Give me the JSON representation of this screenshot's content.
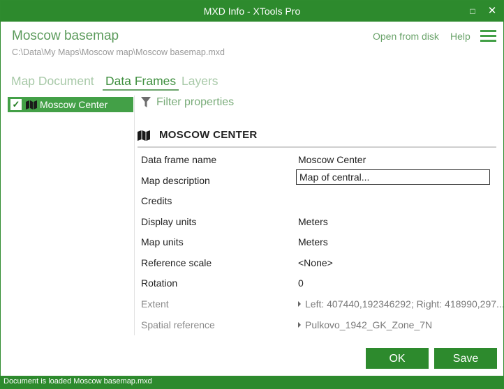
{
  "window": {
    "title": "MXD Info - XTools Pro",
    "maximize_glyph": "□",
    "close_glyph": "✕"
  },
  "header": {
    "doc_title": "Moscow basemap",
    "doc_path": "C:\\Data\\My Maps\\Moscow map\\Moscow basemap.mxd",
    "open_from_disk": "Open from disk",
    "help": "Help",
    "menu_icon": "hamburger-menu-icon"
  },
  "tabs": [
    {
      "label": "Map Document",
      "active": false
    },
    {
      "label": "Data Frames",
      "active": true
    },
    {
      "label": "Layers",
      "active": false
    }
  ],
  "tree": {
    "items": [
      {
        "label": "Moscow Center",
        "checked": true,
        "icon": "map-icon"
      }
    ]
  },
  "filter": {
    "label": "Filter properties",
    "icon": "filter-icon"
  },
  "section": {
    "title": "MOSCOW CENTER",
    "icon": "map-icon"
  },
  "properties": [
    {
      "key": "Data frame name",
      "value": "Moscow Center"
    },
    {
      "key": "Map description",
      "value": "Map of central..."
    },
    {
      "key": "Credits",
      "value": ""
    },
    {
      "key": "Display units",
      "value": "Meters"
    },
    {
      "key": "Map units",
      "value": "Meters"
    },
    {
      "key": "Reference scale",
      "value": "<None>"
    },
    {
      "key": "Rotation",
      "value": "0"
    },
    {
      "key": "Extent",
      "value": "Left: 407440,192346292; Right: 418990,297..."
    },
    {
      "key": "Spatial reference",
      "value": "Pulkovo_1942_GK_Zone_7N"
    }
  ],
  "buttons": {
    "ok": "OK",
    "save": "Save"
  },
  "status": {
    "text": "Document is loaded Moscow basemap.mxd"
  },
  "colors": {
    "accent": "#2d8a2d",
    "tab_inactive": "#a8c9a8",
    "link": "#6aa36a"
  }
}
